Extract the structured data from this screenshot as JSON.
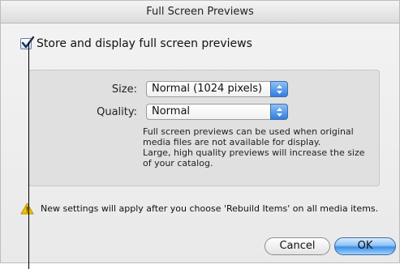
{
  "window": {
    "title": "Full Screen Previews"
  },
  "store_option": {
    "label": "Store and display full screen previews",
    "checked": true
  },
  "size": {
    "label": "Size:",
    "value": "Normal (1024 pixels)"
  },
  "quality": {
    "label": "Quality:",
    "value": "Normal"
  },
  "help_text": {
    "line1": "Full screen previews can be used when original",
    "line2": "media files are not available for display.",
    "line3": "Large, high quality previews will increase the size",
    "line4": "of your catalog."
  },
  "warning": {
    "icon": "warning-icon",
    "text": "New settings will apply after you choose 'Rebuild Items' on all media items."
  },
  "buttons": {
    "cancel": "Cancel",
    "ok": "OK"
  },
  "colors": {
    "accent": "#3e8fe6",
    "warning": "#f2c200"
  }
}
